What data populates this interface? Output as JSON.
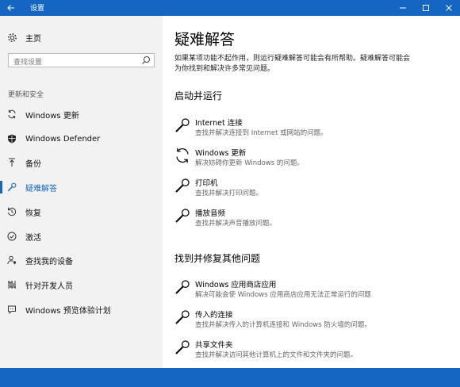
{
  "window": {
    "title": "设置"
  },
  "sidebar": {
    "home_label": "主页",
    "search_placeholder": "查找设置",
    "section_label": "更新和安全",
    "items": [
      {
        "label": "Windows 更新",
        "icon": "sync-icon"
      },
      {
        "label": "Windows Defender",
        "icon": "shield-icon"
      },
      {
        "label": "备份",
        "icon": "backup-arrow-icon"
      },
      {
        "label": "疑难解答",
        "icon": "wrench-icon",
        "active": true
      },
      {
        "label": "恢复",
        "icon": "recovery-icon"
      },
      {
        "label": "激活",
        "icon": "check-circle-icon"
      },
      {
        "label": "查找我的设备",
        "icon": "person-location-icon"
      },
      {
        "label": "针对开发人员",
        "icon": "developer-icon"
      },
      {
        "label": "Windows 预览体验计划",
        "icon": "insider-icon"
      }
    ]
  },
  "main": {
    "title": "疑难解答",
    "description": "如果某项功能不起作用，则运行疑难解答可能会有所帮助。疑难解答可能会为你找到和解决许多常见问题。",
    "sections": [
      {
        "heading": "启动并运行",
        "items": [
          {
            "title": "Internet 连接",
            "desc": "查找并解决连接到 Internet 或网站的问题。",
            "icon": "wrench-icon"
          },
          {
            "title": "Windows 更新",
            "desc": "解决妨碍你更新 Windows 的问题。",
            "icon": "sync-icon"
          },
          {
            "title": "打印机",
            "desc": "查找并解决打印问题。",
            "icon": "wrench-icon"
          },
          {
            "title": "播放音频",
            "desc": "查找并解决声音播放问题。",
            "icon": "wrench-icon"
          }
        ]
      },
      {
        "heading": "找到并修复其他问题",
        "items": [
          {
            "title": "Windows 应用商店应用",
            "desc": "解决可能会使 Windows 应用商店应用无法正常运行的问题",
            "icon": "wrench-icon"
          },
          {
            "title": "传入的连接",
            "desc": "查找并解决传入的计算机连接和 Windows 防火墙的问题。",
            "icon": "wrench-icon"
          },
          {
            "title": "共享文件夹",
            "desc": "查找并解决访问其他计算机上的文件和文件夹的问题。",
            "icon": "wrench-icon"
          }
        ]
      }
    ]
  },
  "colors": {
    "accent": "#1466c2",
    "sidebar_bg": "#f2f2f2"
  }
}
